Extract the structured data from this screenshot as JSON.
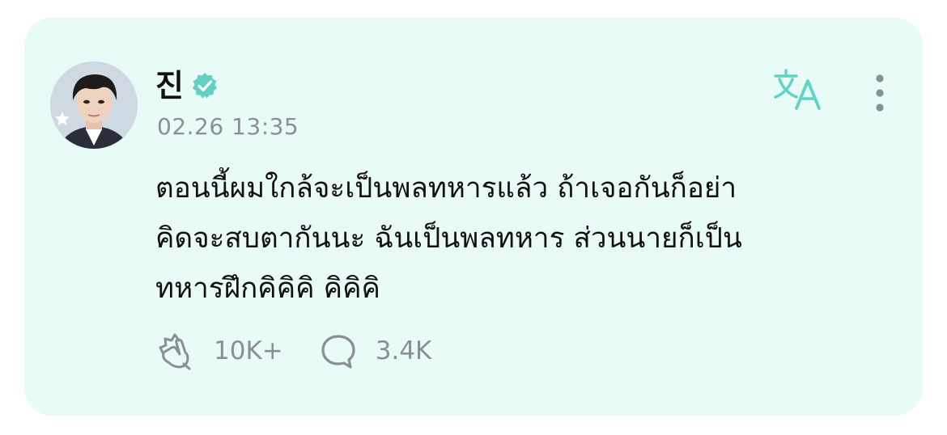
{
  "post": {
    "author": {
      "name": "진",
      "verified_icon": "verified-badge-icon",
      "avatar_icon": "profile-photo",
      "badge_icon": "star-icon"
    },
    "timestamp": "02.26 13:35",
    "body_lines": [
      "ตอนนี้ผมใกล้จะเป็นพลทหารแล้ว ถ้าเจอกันก็อย่า",
      "คิดจะสบตากันนะ ฉันเป็นพลทหาร ส่วนนายก็เป็น",
      "ทหารฝึกคิคิคิ คิคิคิ"
    ],
    "actions": {
      "like_count": "10K+",
      "comment_count": "3.4K"
    },
    "header_icons": [
      "translate-icon",
      "more-vertical-icon"
    ]
  },
  "colors": {
    "card_background": "#e8fbf6",
    "accent": "#5fd3c5",
    "muted_text": "#8a8f93",
    "primary_text": "#111111"
  }
}
